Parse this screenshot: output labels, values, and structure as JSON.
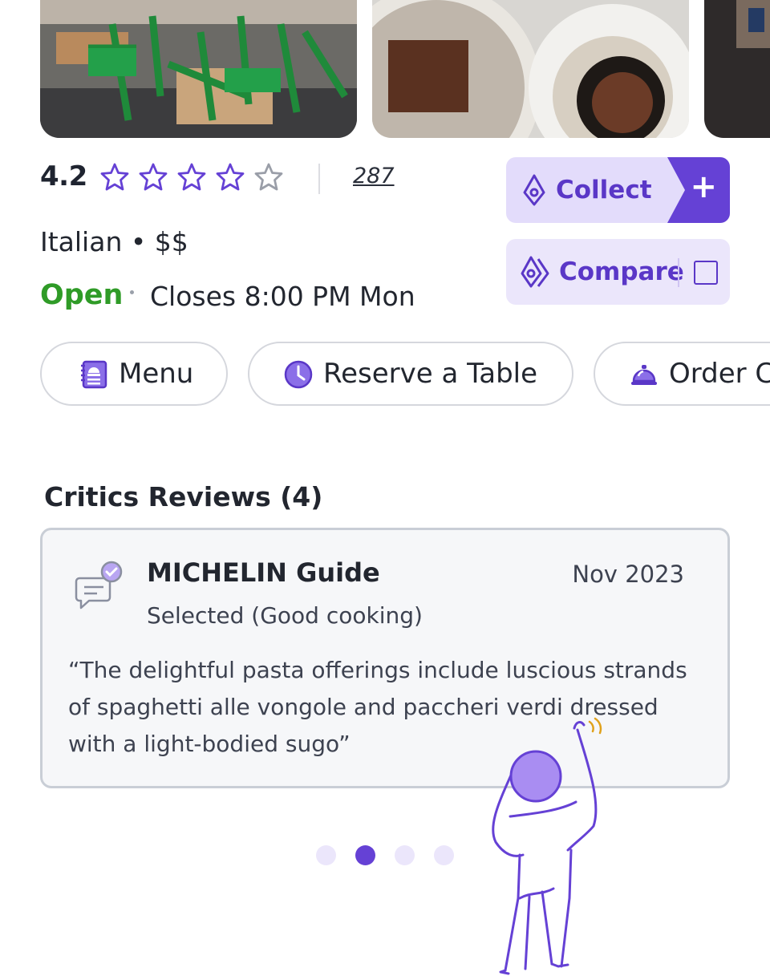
{
  "rating": {
    "value": "4.2",
    "stars_filled": 4.2,
    "stars_total": 5,
    "review_count": "287"
  },
  "info": {
    "category": "Italian • $$",
    "status": "Open",
    "closes": "Closes 8:00 PM  Mon"
  },
  "actions": {
    "collect_label": "Collect",
    "collect_add": "+",
    "compare_label": "Compare"
  },
  "pills": [
    {
      "label": "Menu",
      "icon": "menu-icon"
    },
    {
      "label": "Reserve a Table",
      "icon": "clock-icon"
    },
    {
      "label": "Order C",
      "icon": "service-bell-icon"
    }
  ],
  "critics": {
    "title": "Critics Reviews (4)",
    "card": {
      "source": "MICHELIN Guide",
      "date": "Nov 2023",
      "award": "Selected (Good cooking)",
      "quote": "“The delightful pasta offerings include luscious strands of spaghetti alle vongole and paccheri verdi dressed with a light-bodied sugo”"
    }
  },
  "pager": {
    "count": 4,
    "active_index": 1
  },
  "colors": {
    "accent": "#6541d5",
    "accent_light": "#e3dcfb",
    "open_green": "#2f9b27",
    "card_border": "#c9ced6"
  }
}
